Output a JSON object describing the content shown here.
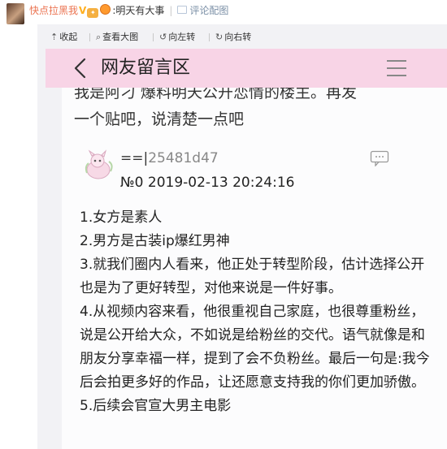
{
  "comment": {
    "user": "快点拉黑我",
    "separator": ":",
    "text": "明天有大事",
    "divider": "|",
    "view_pic_label": "评论配图"
  },
  "toolbar": {
    "items": [
      {
        "icon": "collapse-icon",
        "label": "收起"
      },
      {
        "icon": "zoom-icon",
        "label": "查看大图"
      },
      {
        "icon": "rotate-left-icon",
        "label": "向左转"
      },
      {
        "icon": "rotate-right-icon",
        "label": "向右转"
      }
    ]
  },
  "post": {
    "nav_title": "网友留言区",
    "line_partial": "我是阿刁 爆料明天公开恋情的楼主。再发",
    "line2": "一个贴吧，说清楚一点吧",
    "reply": {
      "user_prefix": "==|",
      "user_id": "25481d47",
      "meta": "№0  2019-02-13 20:24:16",
      "lines": [
        "1.女方是素人",
        "2.男方是古装ip爆红男神",
        "3.就我们圈内人看来，他正处于转型阶段，估计选择公开也是为了更好转型，对他来说是一件好事。",
        "4.从视频内容来看，他很重视自己家庭，也很尊重粉丝，说是公开给大众，不如说是给粉丝的交代。语气就像是和朋友分享幸福一样，提到了会不负粉丝。最后一句是:我今后会拍更多好的作品，让还愿意支持我的你们更加骄傲。",
        "5.后续会官宣大男主电影"
      ]
    }
  },
  "colors": {
    "nav_bar": "#f8d4e6",
    "user_name": "#eb7350",
    "link": "#7a8fa6",
    "panel_bg": "#f2f2f5"
  }
}
